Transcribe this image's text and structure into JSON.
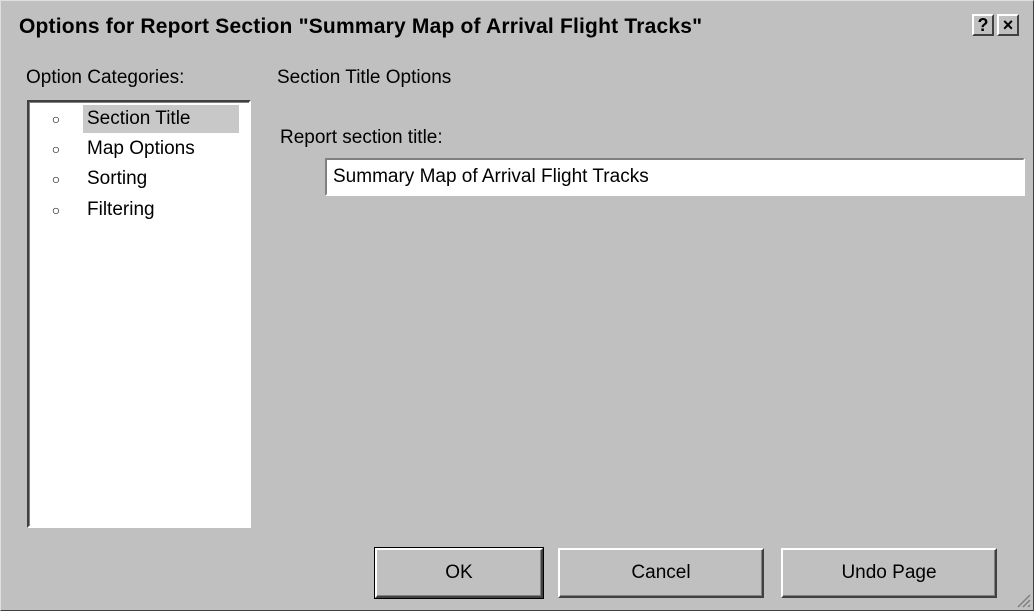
{
  "dialog": {
    "title": "Options for Report Section \"Summary Map of Arrival Flight Tracks\"",
    "help_label": "?",
    "close_label": "×"
  },
  "categories": {
    "label": "Option Categories:",
    "items": [
      {
        "label": "Section Title",
        "selected": true
      },
      {
        "label": "Map Options",
        "selected": false
      },
      {
        "label": "Sorting",
        "selected": false
      },
      {
        "label": "Filtering",
        "selected": false
      }
    ]
  },
  "page": {
    "header": "Section Title Options",
    "field_label": "Report section title:",
    "field_value": "Summary Map of Arrival Flight Tracks"
  },
  "buttons": {
    "ok": "OK",
    "cancel": "Cancel",
    "undo": "Undo Page"
  }
}
